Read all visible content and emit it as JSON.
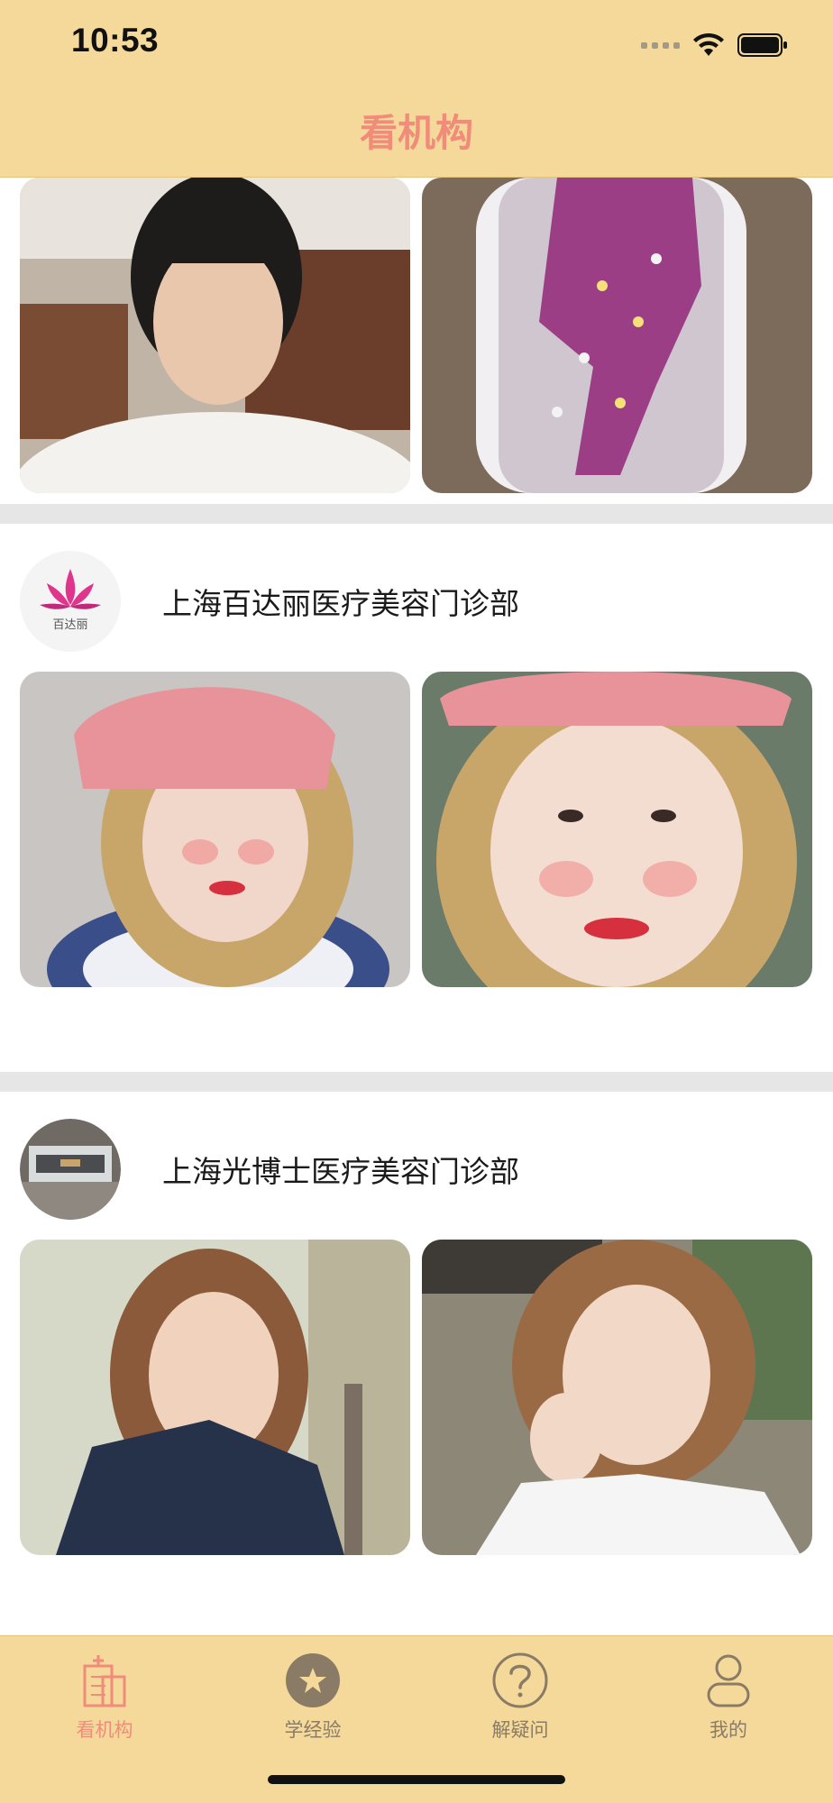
{
  "status_bar": {
    "time": "10:53"
  },
  "nav": {
    "title": "看机构"
  },
  "clinics": [
    {
      "name": "上海百达丽医疗美容门诊部",
      "logo_text": "百达丽"
    },
    {
      "name": "上海光博士医疗美容门诊部"
    }
  ],
  "tabbar": {
    "items": [
      {
        "label": "看机构",
        "icon": "building-icon",
        "active": true
      },
      {
        "label": "学经验",
        "icon": "star-icon",
        "active": false
      },
      {
        "label": "解疑问",
        "icon": "question-icon",
        "active": false
      },
      {
        "label": "我的",
        "icon": "person-icon",
        "active": false
      }
    ]
  },
  "colors": {
    "header_bg": "#f5d99a",
    "accent": "#f18c7b",
    "tab_inactive": "#8a7b66",
    "divider": "#e6e6e6"
  }
}
